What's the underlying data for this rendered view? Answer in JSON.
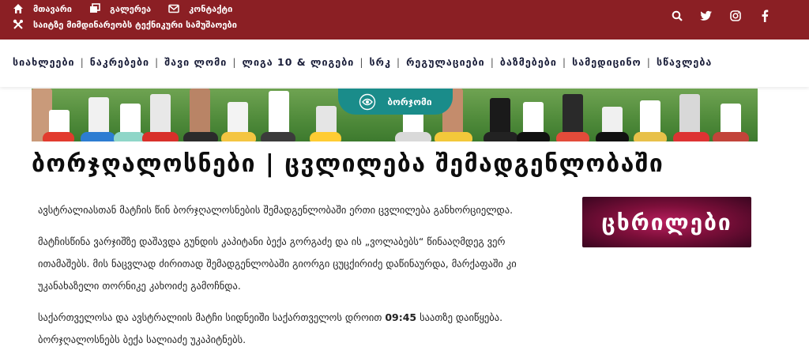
{
  "topbar": {
    "links_row1": [
      {
        "label": "მთავარი",
        "icon": "home-icon"
      },
      {
        "label": "გალერეა",
        "icon": "gallery-icon"
      },
      {
        "label": "კონტაქტი",
        "icon": "mail-icon"
      }
    ],
    "tech_service_label": "საიტზე მიმდინარეობს ტექნიკური სამუშაოები",
    "social_icons": [
      "search-icon",
      "twitter-icon",
      "instagram-icon",
      "facebook-icon"
    ]
  },
  "nav": {
    "items": [
      "სიახლეები",
      "ნაკრებები",
      "შავი ლომი",
      "ლიგა 10 & ლიგები",
      "სრკ",
      "რეგულაციები",
      "ბაზმებები",
      "სამედიცინო",
      "სწავლება"
    ]
  },
  "banner": {
    "badge_label": "ბორჯომი"
  },
  "article": {
    "title": "ბორჯღალოსნები | ცვლილება შემადგენლობაში",
    "p1": "ავსტრალიასთან მატჩის წინ ბორჯღალოსნების შემადგენლობაში ერთი ცვლილება განხორციელდა.",
    "p2": "მატჩისწინა ვარჯიშზე დაშავდა გუნდის კაპიტანი ბექა გორგაძე და ის „ვოლაბებს“ წინააღმდეგ ვერ ითამაშებს. მის ნაცვლად ძირითად შემადგენლობაში გიორგი ცუცქირიძე დაწინაურდა, მარქაფაში კი უკანახაზელი თორნიკე კახოიძე გამოჩნდა.",
    "p3_before": "საქართველოსა და ავსტრალიის მატჩი სიდნეიში საქართველოს დროით ",
    "p3_time": "09:45",
    "p3_after": " საათზე დაიწყება.",
    "p3_line2": "ბორჯღალოსნებს ბექა სალიაძე უკაპიტნებს."
  },
  "ad": {
    "label": "ცხრილები"
  },
  "colors": {
    "topbar_bg": "#8b1f24",
    "badge_bg": "#1a8c8a",
    "nav_text": "#1b1f3a",
    "ad_accent": "#b81f5e"
  }
}
